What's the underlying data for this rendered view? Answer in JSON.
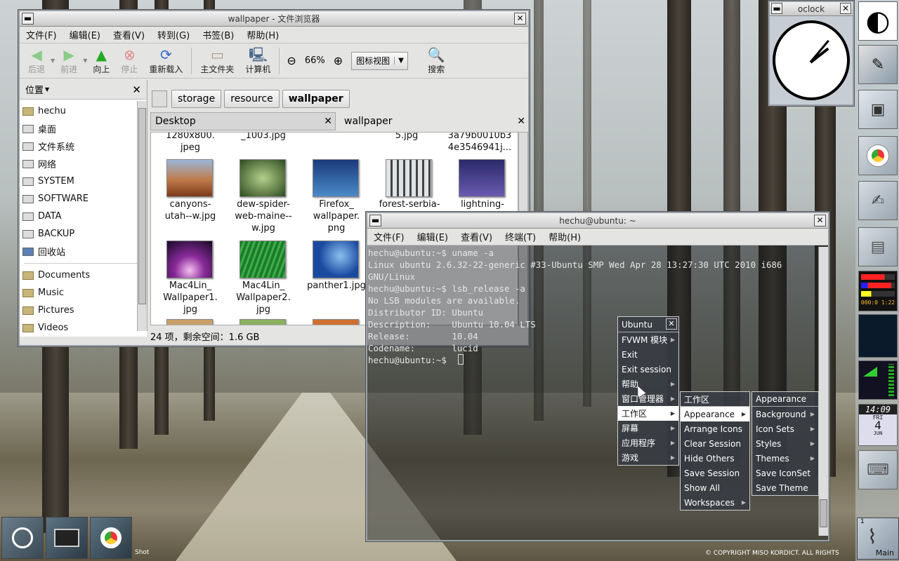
{
  "fm": {
    "title": "wallpaper - 文件浏览器",
    "menus": [
      "文件(F)",
      "编辑(E)",
      "查看(V)",
      "转到(G)",
      "书签(B)",
      "帮助(H)"
    ],
    "toolbar": {
      "back": "后退",
      "forward": "前进",
      "up": "向上",
      "stop": "停止",
      "reload": "重新载入",
      "home": "主文件夹",
      "computer": "计算机",
      "zoom": "66%",
      "view": "图标视图",
      "search": "搜索"
    },
    "side_title": "位置",
    "places": [
      "hechu",
      "桌面",
      "文件系统",
      "网络",
      "SYSTEM",
      "SOFTWARE",
      "DATA",
      "BACKUP",
      "回收站"
    ],
    "bookmarks": [
      "Documents",
      "Music",
      "Pictures",
      "Videos"
    ],
    "crumbs": [
      "storage",
      "resource",
      "wallpaper"
    ],
    "tab_desktop": "Desktop",
    "tab_wallpaper": "wallpaper",
    "top_caps": [
      "1280x800.\njpeg",
      "_1003.jpg",
      "5.jpg",
      "3a79b0010b3\n4e3546941j..."
    ],
    "files": [
      "canyons-\nutah--w.jpg",
      "dew-spider-\nweb-maine--\nw.jpg",
      "Firefox_\nwallpaper.\npng",
      "forest-serbia-",
      "lightning-",
      "Mac4Lin_\nWallpaper1.\njpg",
      "Mac4Lin_\nWallpaper2.\njpg",
      "panther1.jpg"
    ],
    "status": "24 项，剩余空间：1.6 GB"
  },
  "term": {
    "title": "hechu@ubuntu: ~",
    "menus": [
      "文件(F)",
      "编辑(E)",
      "查看(V)",
      "终端(T)",
      "帮助(H)"
    ],
    "lines": "hechu@ubuntu:~$ uname -a\nLinux ubuntu 2.6.32-22-generic #33-Ubuntu SMP Wed Apr 28 13:27:30 UTC 2010 i686\nGNU/Linux\nhechu@ubuntu:~$ lsb_release -a\nNo LSB modules are available.\nDistributor ID: Ubuntu\nDescription:    Ubuntu 10.04 LTS\nRelease:        10.04\nCodename:       lucid\nhechu@ubuntu:~$ "
  },
  "menu1": {
    "title": "Ubuntu",
    "items": [
      "FVWM 模块",
      "Exit",
      "Exit session",
      "帮助",
      "窗口管理器",
      "工作区",
      "屏幕",
      "应用程序",
      "游戏"
    ]
  },
  "menu2": {
    "items": [
      "工作区",
      "Appearance",
      "Arrange Icons",
      "Clear Session",
      "Hide Others",
      "Save Session",
      "Show All",
      "Workspaces"
    ]
  },
  "menu3": {
    "items": [
      "Appearance",
      "Background",
      "Icon Sets",
      "Styles",
      "Themes",
      "Save IconSet",
      "Save Theme"
    ]
  },
  "clock": {
    "title": "oclock",
    "time": "14:09",
    "day": "FRI",
    "date": "4",
    "month": "JUN",
    "cpu": "000:0 1:22"
  },
  "pager": {
    "label": "Main",
    "num": "1"
  },
  "copyright": "© COPYRIGHT MISO KORDICT. ALL RIGHTS",
  "shot": "Shot"
}
